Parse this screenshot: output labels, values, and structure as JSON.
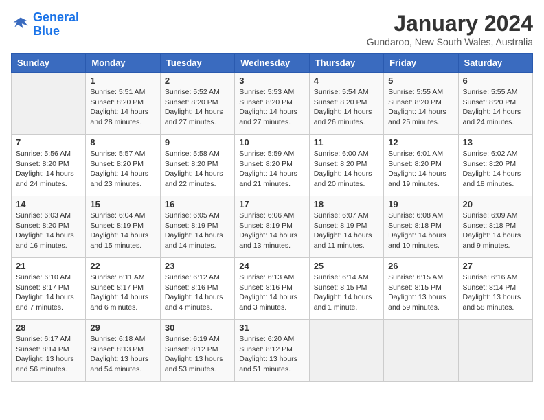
{
  "header": {
    "logo_line1": "General",
    "logo_line2": "Blue",
    "month": "January 2024",
    "location": "Gundaroo, New South Wales, Australia"
  },
  "weekdays": [
    "Sunday",
    "Monday",
    "Tuesday",
    "Wednesday",
    "Thursday",
    "Friday",
    "Saturday"
  ],
  "weeks": [
    [
      {
        "day": "",
        "empty": true
      },
      {
        "day": "1",
        "sunrise": "5:51 AM",
        "sunset": "8:20 PM",
        "daylight": "14 hours and 28 minutes."
      },
      {
        "day": "2",
        "sunrise": "5:52 AM",
        "sunset": "8:20 PM",
        "daylight": "14 hours and 27 minutes."
      },
      {
        "day": "3",
        "sunrise": "5:53 AM",
        "sunset": "8:20 PM",
        "daylight": "14 hours and 27 minutes."
      },
      {
        "day": "4",
        "sunrise": "5:54 AM",
        "sunset": "8:20 PM",
        "daylight": "14 hours and 26 minutes."
      },
      {
        "day": "5",
        "sunrise": "5:55 AM",
        "sunset": "8:20 PM",
        "daylight": "14 hours and 25 minutes."
      },
      {
        "day": "6",
        "sunrise": "5:55 AM",
        "sunset": "8:20 PM",
        "daylight": "14 hours and 24 minutes."
      }
    ],
    [
      {
        "day": "7",
        "sunrise": "5:56 AM",
        "sunset": "8:20 PM",
        "daylight": "14 hours and 24 minutes."
      },
      {
        "day": "8",
        "sunrise": "5:57 AM",
        "sunset": "8:20 PM",
        "daylight": "14 hours and 23 minutes."
      },
      {
        "day": "9",
        "sunrise": "5:58 AM",
        "sunset": "8:20 PM",
        "daylight": "14 hours and 22 minutes."
      },
      {
        "day": "10",
        "sunrise": "5:59 AM",
        "sunset": "8:20 PM",
        "daylight": "14 hours and 21 minutes."
      },
      {
        "day": "11",
        "sunrise": "6:00 AM",
        "sunset": "8:20 PM",
        "daylight": "14 hours and 20 minutes."
      },
      {
        "day": "12",
        "sunrise": "6:01 AM",
        "sunset": "8:20 PM",
        "daylight": "14 hours and 19 minutes."
      },
      {
        "day": "13",
        "sunrise": "6:02 AM",
        "sunset": "8:20 PM",
        "daylight": "14 hours and 18 minutes."
      }
    ],
    [
      {
        "day": "14",
        "sunrise": "6:03 AM",
        "sunset": "8:20 PM",
        "daylight": "14 hours and 16 minutes."
      },
      {
        "day": "15",
        "sunrise": "6:04 AM",
        "sunset": "8:19 PM",
        "daylight": "14 hours and 15 minutes."
      },
      {
        "day": "16",
        "sunrise": "6:05 AM",
        "sunset": "8:19 PM",
        "daylight": "14 hours and 14 minutes."
      },
      {
        "day": "17",
        "sunrise": "6:06 AM",
        "sunset": "8:19 PM",
        "daylight": "14 hours and 13 minutes."
      },
      {
        "day": "18",
        "sunrise": "6:07 AM",
        "sunset": "8:19 PM",
        "daylight": "14 hours and 11 minutes."
      },
      {
        "day": "19",
        "sunrise": "6:08 AM",
        "sunset": "8:18 PM",
        "daylight": "14 hours and 10 minutes."
      },
      {
        "day": "20",
        "sunrise": "6:09 AM",
        "sunset": "8:18 PM",
        "daylight": "14 hours and 9 minutes."
      }
    ],
    [
      {
        "day": "21",
        "sunrise": "6:10 AM",
        "sunset": "8:17 PM",
        "daylight": "14 hours and 7 minutes."
      },
      {
        "day": "22",
        "sunrise": "6:11 AM",
        "sunset": "8:17 PM",
        "daylight": "14 hours and 6 minutes."
      },
      {
        "day": "23",
        "sunrise": "6:12 AM",
        "sunset": "8:16 PM",
        "daylight": "14 hours and 4 minutes."
      },
      {
        "day": "24",
        "sunrise": "6:13 AM",
        "sunset": "8:16 PM",
        "daylight": "14 hours and 3 minutes."
      },
      {
        "day": "25",
        "sunrise": "6:14 AM",
        "sunset": "8:15 PM",
        "daylight": "14 hours and 1 minute."
      },
      {
        "day": "26",
        "sunrise": "6:15 AM",
        "sunset": "8:15 PM",
        "daylight": "13 hours and 59 minutes."
      },
      {
        "day": "27",
        "sunrise": "6:16 AM",
        "sunset": "8:14 PM",
        "daylight": "13 hours and 58 minutes."
      }
    ],
    [
      {
        "day": "28",
        "sunrise": "6:17 AM",
        "sunset": "8:14 PM",
        "daylight": "13 hours and 56 minutes."
      },
      {
        "day": "29",
        "sunrise": "6:18 AM",
        "sunset": "8:13 PM",
        "daylight": "13 hours and 54 minutes."
      },
      {
        "day": "30",
        "sunrise": "6:19 AM",
        "sunset": "8:12 PM",
        "daylight": "13 hours and 53 minutes."
      },
      {
        "day": "31",
        "sunrise": "6:20 AM",
        "sunset": "8:12 PM",
        "daylight": "13 hours and 51 minutes."
      },
      {
        "day": "",
        "empty": true
      },
      {
        "day": "",
        "empty": true
      },
      {
        "day": "",
        "empty": true
      }
    ]
  ]
}
